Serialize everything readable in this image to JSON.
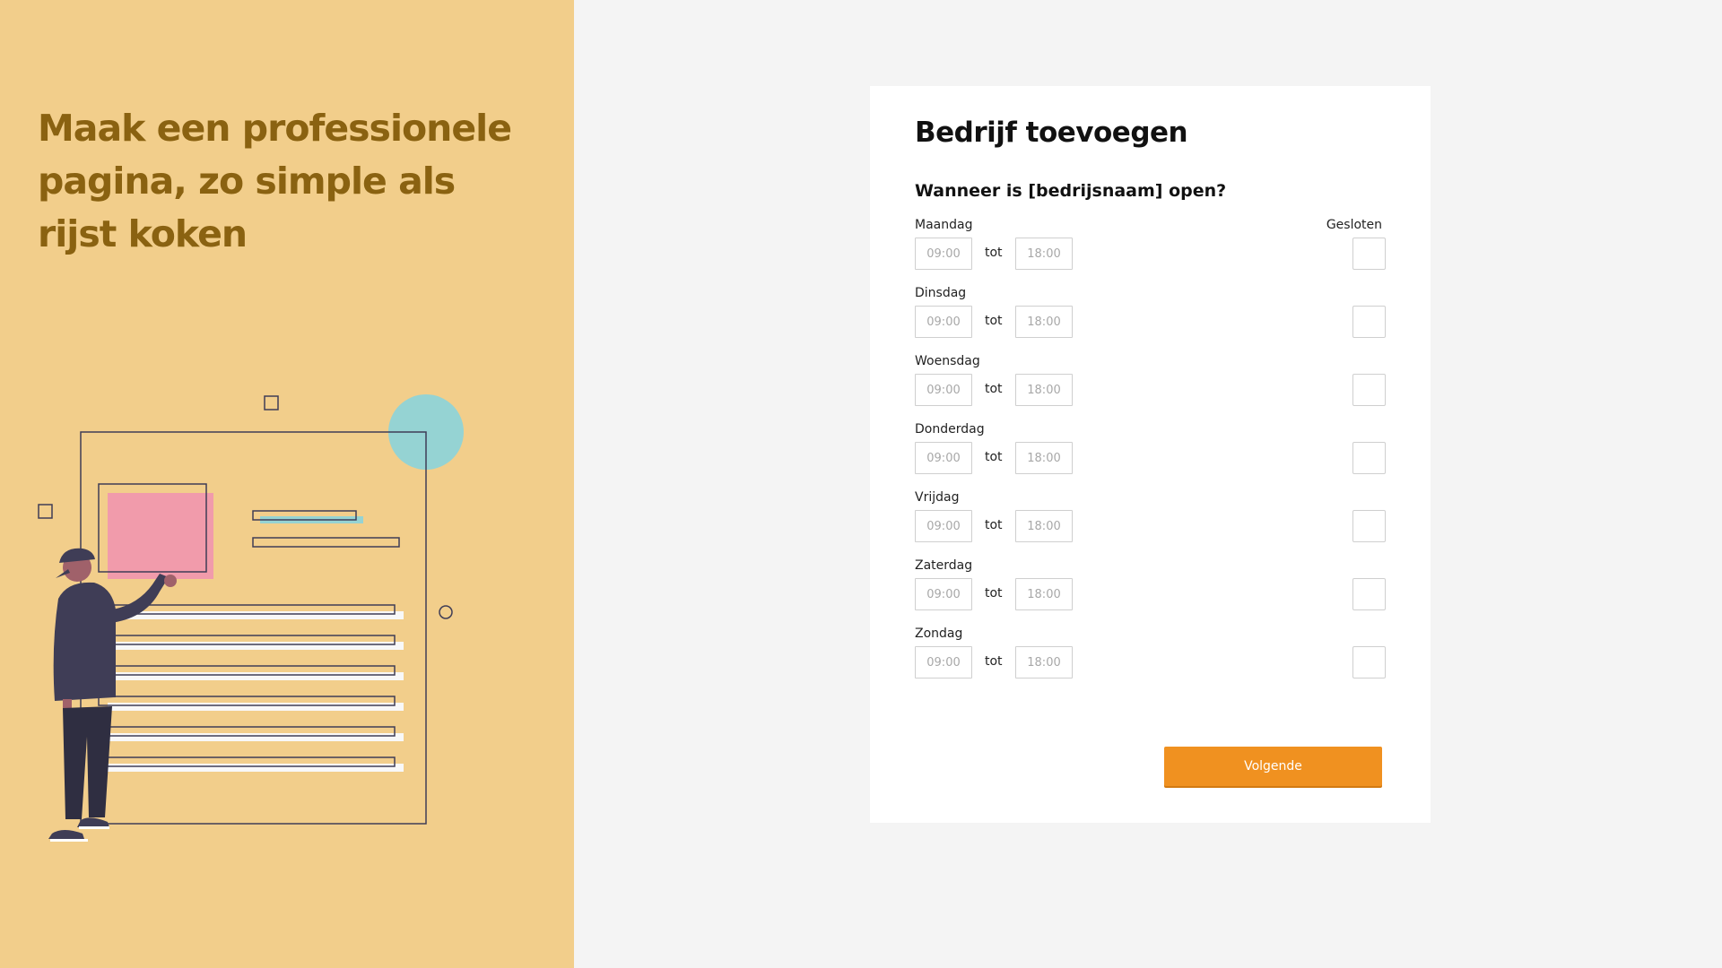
{
  "hero": {
    "title": "Maak een professionele pagina, zo simple als rijst koken"
  },
  "form": {
    "title": "Bedrijf toevoegen",
    "question": "Wanneer is [bedrijsnaam] open?",
    "closed_label": "Gesloten",
    "separator": "tot",
    "open_placeholder": "09:00",
    "close_placeholder": "18:00",
    "days": [
      {
        "label": "Maandag"
      },
      {
        "label": "Dinsdag"
      },
      {
        "label": "Woensdag"
      },
      {
        "label": "Donderdag"
      },
      {
        "label": "Vrijdag"
      },
      {
        "label": "Zaterdag"
      },
      {
        "label": "Zondag"
      }
    ],
    "next_label": "Volgende"
  },
  "colors": {
    "panel_bg": "#f2ce8b",
    "title": "#8a6211",
    "accent": "#f09120",
    "circle": "#95d3d3",
    "pink": "#f19bab",
    "figure": "#3f3d56"
  }
}
